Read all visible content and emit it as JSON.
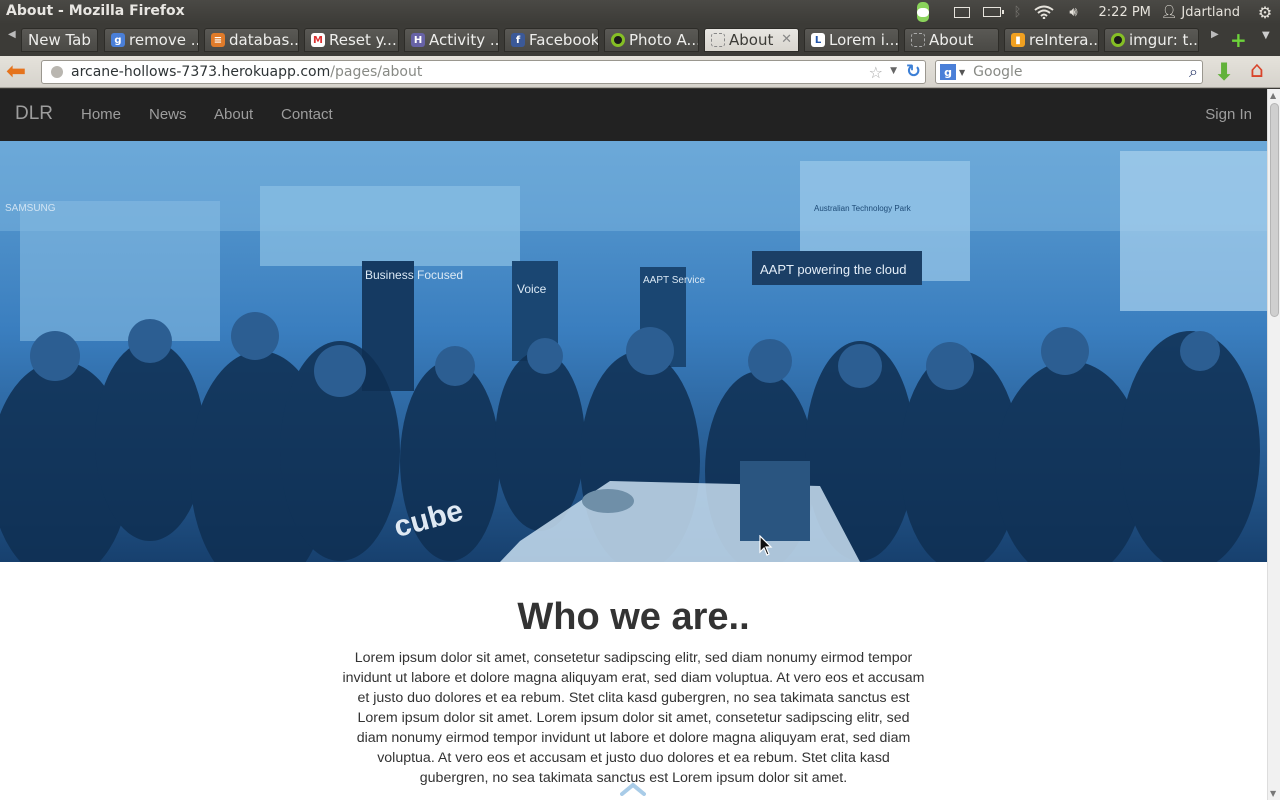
{
  "os_panel": {
    "window_title": "About - Mozilla Firefox",
    "clock": "2:22 PM",
    "username": "Jdartland"
  },
  "tabs": [
    {
      "label": "New Tab",
      "icon": "blank-icon",
      "active": false
    },
    {
      "label": "remove ...",
      "icon": "google-icon",
      "active": false
    },
    {
      "label": "databas...",
      "icon": "stack-icon",
      "active": false
    },
    {
      "label": "Reset y...",
      "icon": "gmail-icon",
      "active": false
    },
    {
      "label": "Activity ...",
      "icon": "heroku-icon",
      "active": false
    },
    {
      "label": "Facebook",
      "icon": "facebook-icon",
      "active": false
    },
    {
      "label": "Photo A...",
      "icon": "imgur-icon",
      "active": false
    },
    {
      "label": "About",
      "icon": "blank-icon",
      "active": true
    },
    {
      "label": "Lorem i...",
      "icon": "lorem-icon",
      "active": false
    },
    {
      "label": "About",
      "icon": "blank-icon",
      "active": false
    },
    {
      "label": "reIntera...",
      "icon": "bookmark-icon",
      "active": false
    },
    {
      "label": "imgur: t...",
      "icon": "imgur-icon",
      "active": false
    }
  ],
  "toolbar": {
    "url_host": "arcane-hollows-7373.herokuapp.com",
    "url_path": "/pages/about",
    "search_placeholder": "Google"
  },
  "site": {
    "brand": "DLR",
    "nav_items": [
      "Home",
      "News",
      "About",
      "Contact"
    ],
    "sign_in": "Sign In",
    "headline": "Who we are..",
    "body": "Lorem ipsum dolor sit amet, consetetur sadipscing elitr, sed diam nonumy eirmod tempor invidunt ut labore et dolore magna aliquyam erat, sed diam voluptua. At vero eos et accusam et justo duo dolores et ea rebum. Stet clita kasd gubergren, no sea takimata sanctus est Lorem ipsum dolor sit amet. Lorem ipsum dolor sit amet, consetetur sadipscing elitr, sed diam nonumy eirmod tempor invidunt ut labore et dolore magna aliquyam erat, sed diam voluptua. At vero eos et accusam et justo duo dolores et ea rebum. Stet clita kasd gubergren, no sea takimata sanctus est Lorem ipsum dolor sit amet.",
    "hero": {
      "signs": [
        "Business Focused",
        "Voice",
        "AAPT Service",
        "AAPT powering the cloud",
        "cube",
        "Australian Technology Park",
        "SAMSUNG"
      ],
      "tint_color": "#2a6fb0"
    }
  },
  "colors": {
    "site_nav_bg": "#222222",
    "nav_link": "#9d9d9d",
    "headline": "#333333",
    "accent_chevron": "#a9cce8"
  }
}
